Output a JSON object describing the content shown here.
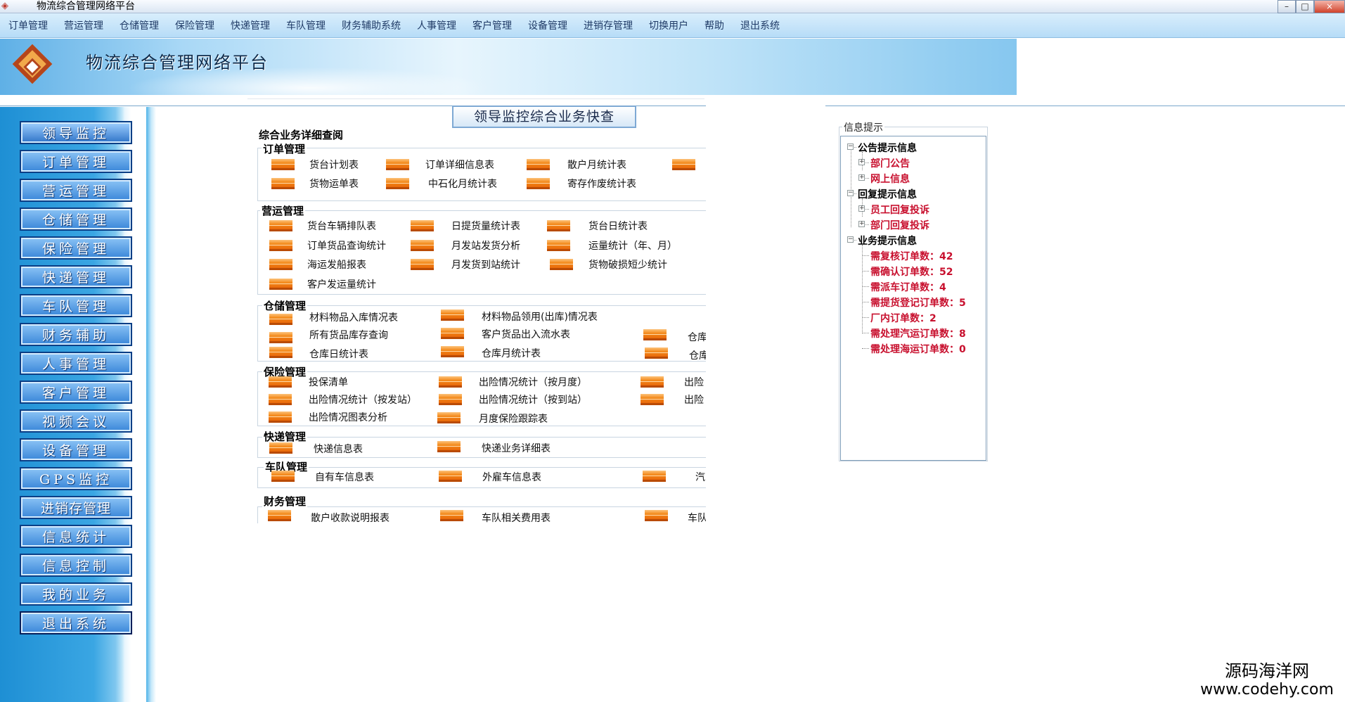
{
  "window": {
    "title": "物流综合管理网络平台",
    "controls": {
      "minimize": "–",
      "maximize": "□",
      "close": "×"
    }
  },
  "menubar": {
    "items": [
      "订单管理",
      "营运管理",
      "仓储管理",
      "保险管理",
      "快递管理",
      "车队管理",
      "财务辅助系统",
      "人事管理",
      "客户管理",
      "设备管理",
      "进销存管理",
      "切换用户",
      "帮助",
      "退出系统"
    ]
  },
  "banner": {
    "title": "物流综合管理网络平台"
  },
  "sidebar": {
    "items": [
      "领导监控",
      "订单管理",
      "营运管理",
      "仓储管理",
      "保险管理",
      "快递管理",
      "车队管理",
      "财务辅助",
      "人事管理",
      "客户管理",
      "视频会议",
      "设备管理",
      "GPS监控",
      "进销存管理",
      "信息统计",
      "信息控制",
      "我的业务",
      "退出系统"
    ]
  },
  "page": {
    "header_button": "领导监控综合业务快查",
    "section_title": "综合业务详细查阅"
  },
  "groups": {
    "order": {
      "title": "订单管理",
      "links": [
        "货台计划表",
        "订单详细信息表",
        "散户月统计表",
        "货物运单表",
        "中石化月统计表",
        "寄存作废统计表"
      ]
    },
    "ops": {
      "title": "营运管理",
      "links": [
        "货台车辆排队表",
        "日提货量统计表",
        "货台日统计表",
        "订单货品查询统计",
        "月发站发货分析",
        "运量统计（年、月）",
        "海运发船报表",
        "月发货到站统计",
        "货物破损短少统计",
        "客户发运量统计"
      ]
    },
    "storage": {
      "title": "仓储管理",
      "links": [
        "材料物品入库情况表",
        "材料物品领用(出库)情况表",
        "所有货品库存查询",
        "客户货品出入流水表",
        "仓库",
        "仓库日统计表",
        "仓库月统计表",
        "仓库"
      ]
    },
    "insurance": {
      "title": "保险管理",
      "links": [
        "投保清单",
        "出险情况统计（按月度）",
        "出险",
        "出险情况统计（按发站）",
        "出险情况统计（按到站）",
        "出险",
        "出险情况图表分析",
        "月度保险跟踪表"
      ]
    },
    "express": {
      "title": "快递管理",
      "links": [
        "快递信息表",
        "快递业务详细表"
      ]
    },
    "fleet": {
      "title": "车队管理",
      "links": [
        "自有车信息表",
        "外雇车信息表",
        "汽"
      ]
    },
    "finance": {
      "title": "财务管理",
      "links": [
        "散户收款说明报表",
        "车队相关费用表",
        "车队"
      ]
    }
  },
  "info_panel": {
    "title": "信息提示",
    "tree": {
      "announce": {
        "label": "公告提示信息",
        "children": [
          "部门公告",
          "网上信息"
        ]
      },
      "reply": {
        "label": "回复提示信息",
        "children": [
          "员工回复投诉",
          "部门回复投诉"
        ]
      },
      "business": {
        "label": "业务提示信息",
        "children": [
          "需复核订单数：42",
          "需确认订单数：52",
          "需派车订单数：4",
          "需提货登记订单数：5",
          "厂内订单数：2",
          "需处理汽运订单数：8",
          "需处理海运订单数：0"
        ]
      }
    }
  },
  "watermark": {
    "line1": "源码海洋网",
    "line2": "www.codehy.com"
  }
}
